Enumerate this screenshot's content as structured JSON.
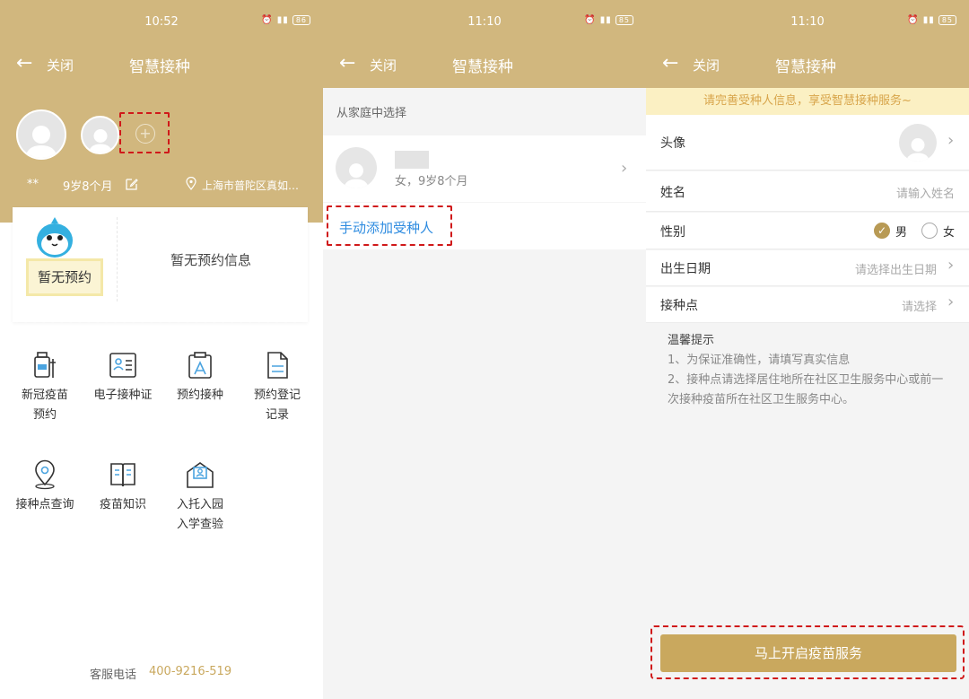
{
  "panels": [
    {
      "status": {
        "time": "10:52",
        "battery": "86"
      },
      "nav": {
        "back": "←",
        "close": "关闭",
        "title": "智慧接种"
      },
      "profile": {
        "name_masked": "**",
        "age": "9岁8个月",
        "location": "上海市普陀区真如…"
      },
      "card": {
        "badge": "暂无预约",
        "info": "暂无预约信息"
      },
      "menu": [
        {
          "label": "新冠疫苗\n预约",
          "icon": "vaccine-bottle-icon"
        },
        {
          "label": "电子接种证",
          "icon": "id-card-icon"
        },
        {
          "label": "预约接种",
          "icon": "clipboard-icon"
        },
        {
          "label": "预约登记\n记录",
          "icon": "document-icon"
        },
        {
          "label": "接种点查询",
          "icon": "location-pin-icon"
        },
        {
          "label": "疫苗知识",
          "icon": "book-icon"
        },
        {
          "label": "入托入园\n入学查验",
          "icon": "certificate-icon"
        }
      ],
      "hotline": {
        "label": "客服电话",
        "number": "400-9216-519"
      }
    },
    {
      "status": {
        "time": "11:10",
        "battery": "85"
      },
      "nav": {
        "back": "←",
        "close": "关闭",
        "title": "智慧接种"
      },
      "section": "从家庭中选择",
      "member": {
        "sub": "女，9岁8个月"
      },
      "add_label": "手动添加受种人"
    },
    {
      "status": {
        "time": "11:10",
        "battery": "85"
      },
      "nav": {
        "back": "←",
        "close": "关闭",
        "title": "智慧接种"
      },
      "banner": "请完善受种人信息，享受智慧接种服务~",
      "form": {
        "avatar_label": "头像",
        "name_label": "姓名",
        "name_placeholder": "请输入姓名",
        "gender_label": "性别",
        "gender_male": "男",
        "gender_female": "女",
        "gender_selected": "男",
        "dob_label": "出生日期",
        "dob_placeholder": "请选择出生日期",
        "site_label": "接种点",
        "site_placeholder": "请选择"
      },
      "tips": {
        "title": "温馨提示",
        "line1": "1、为保证准确性，请填写真实信息",
        "line2": "2、接种点请选择居住地所在社区卫生服务中心或前一次接种疫苗所在社区卫生服务中心。"
      },
      "cta": "马上开启疫苗服务"
    }
  ],
  "colors": {
    "brand": "#d1b77e",
    "button": "#c9a85e",
    "highlight": "#d0191a",
    "link": "#2f8ce0",
    "banner_text": "#d8a54b"
  }
}
